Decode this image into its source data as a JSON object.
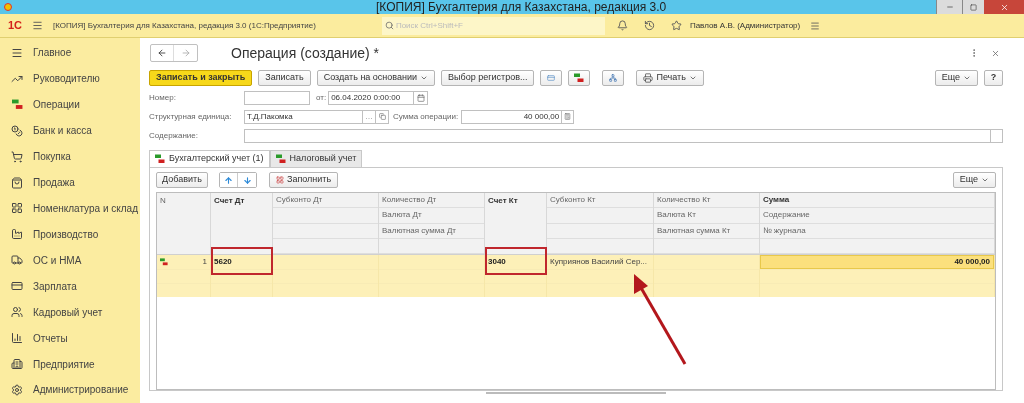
{
  "window": {
    "title": "[КОПИЯ] Бухгалтерия для Казахстана, редакция 3.0"
  },
  "app_bar": {
    "logo": "1С",
    "title": "[КОПИЯ] Бухгалтерия для Казахстана, редакция 3.0  (1С:Предприятие)",
    "search": {
      "placeholder": "Поиск Ctrl+Shift+F"
    },
    "user": "Павлов А.В. (Администратор)"
  },
  "sidebar": {
    "items": [
      {
        "label": "Главное"
      },
      {
        "label": "Руководителю"
      },
      {
        "label": "Операции"
      },
      {
        "label": "Банк и касса"
      },
      {
        "label": "Покупка"
      },
      {
        "label": "Продажа"
      },
      {
        "label": "Номенклатура и склад"
      },
      {
        "label": "Производство"
      },
      {
        "label": "ОС и НМА"
      },
      {
        "label": "Зарплата"
      },
      {
        "label": "Кадровый учет"
      },
      {
        "label": "Отчеты"
      },
      {
        "label": "Предприятие"
      },
      {
        "label": "Администрирование"
      }
    ]
  },
  "form": {
    "title": "Операция (создание) *",
    "toolbar": [
      {
        "label": "Записать и закрыть",
        "kind": "primary"
      },
      {
        "label": "Записать",
        "kind": "plain"
      },
      {
        "label": "Создать на основании",
        "kind": "dropdown"
      },
      {
        "label": "Выбор регистров...",
        "kind": "plain"
      },
      {
        "kind": "icon-card"
      },
      {
        "kind": "icon-dtkt"
      },
      {
        "kind": "icon-struct"
      },
      {
        "label": "Печать",
        "kind": "print"
      }
    ],
    "more": "Еще",
    "help": "?",
    "number": {
      "label": "Номер:"
    },
    "date": {
      "label": "от:",
      "value": "06.04.2020  0:00:00"
    },
    "unit": {
      "label": "Структурная единица:",
      "value": "Т.Д.Пакомка",
      "select_button": "…"
    },
    "sum": {
      "label": "Сумма операции:",
      "value": "40 000,00"
    },
    "content": {
      "label": "Содержание:"
    },
    "tabs": [
      {
        "label": "Бухгалтерский учет (1)",
        "selected": true
      },
      {
        "label": "Налоговый учет",
        "selected": false
      }
    ],
    "table_toolbar": {
      "add": "Добавить",
      "fill": "Заполнить",
      "more": "Еще"
    },
    "table": {
      "columns": [
        {
          "lines": [
            "N"
          ],
          "bold": false,
          "kind": "single"
        },
        {
          "lines": [
            "Счет Дт"
          ],
          "bold": true,
          "kind": "single"
        },
        {
          "lines": [
            "Субконто Дт"
          ],
          "bold": false,
          "kind": "stacked"
        },
        {
          "lines": [
            "Количество Дт",
            "Валюта Дт",
            "Валютная сумма Дт"
          ],
          "bold": false,
          "kind": "stacked"
        },
        {
          "lines": [
            "Счет Кт"
          ],
          "bold": true,
          "kind": "single"
        },
        {
          "lines": [
            "Субконто Кт"
          ],
          "bold": false,
          "kind": "stacked"
        },
        {
          "lines": [
            "Количество Кт",
            "Валюта Кт",
            "Валютная сумма Кт"
          ],
          "bold": false,
          "kind": "stacked"
        },
        {
          "lines": [
            "Сумма",
            "Содержание",
            "№ журнала"
          ],
          "bold": true,
          "kind": "stacked"
        }
      ],
      "rows": [
        {
          "cells": [
            {
              "text": "1",
              "highlighted": false,
              "selected": false
            },
            {
              "text": "5620",
              "highlighted": true,
              "selected": false
            },
            {
              "highlighted": false,
              "selected": false
            },
            {
              "highlighted": false,
              "selected": false
            },
            {
              "text": "3040",
              "highlighted": true,
              "selected": false
            },
            {
              "text": "Куприянов Василий Сер...",
              "highlighted": false,
              "selected": false
            },
            {
              "highlighted": false,
              "selected": false
            },
            {
              "text": "40 000,00",
              "highlighted": false,
              "selected": true
            }
          ]
        }
      ]
    }
  }
}
